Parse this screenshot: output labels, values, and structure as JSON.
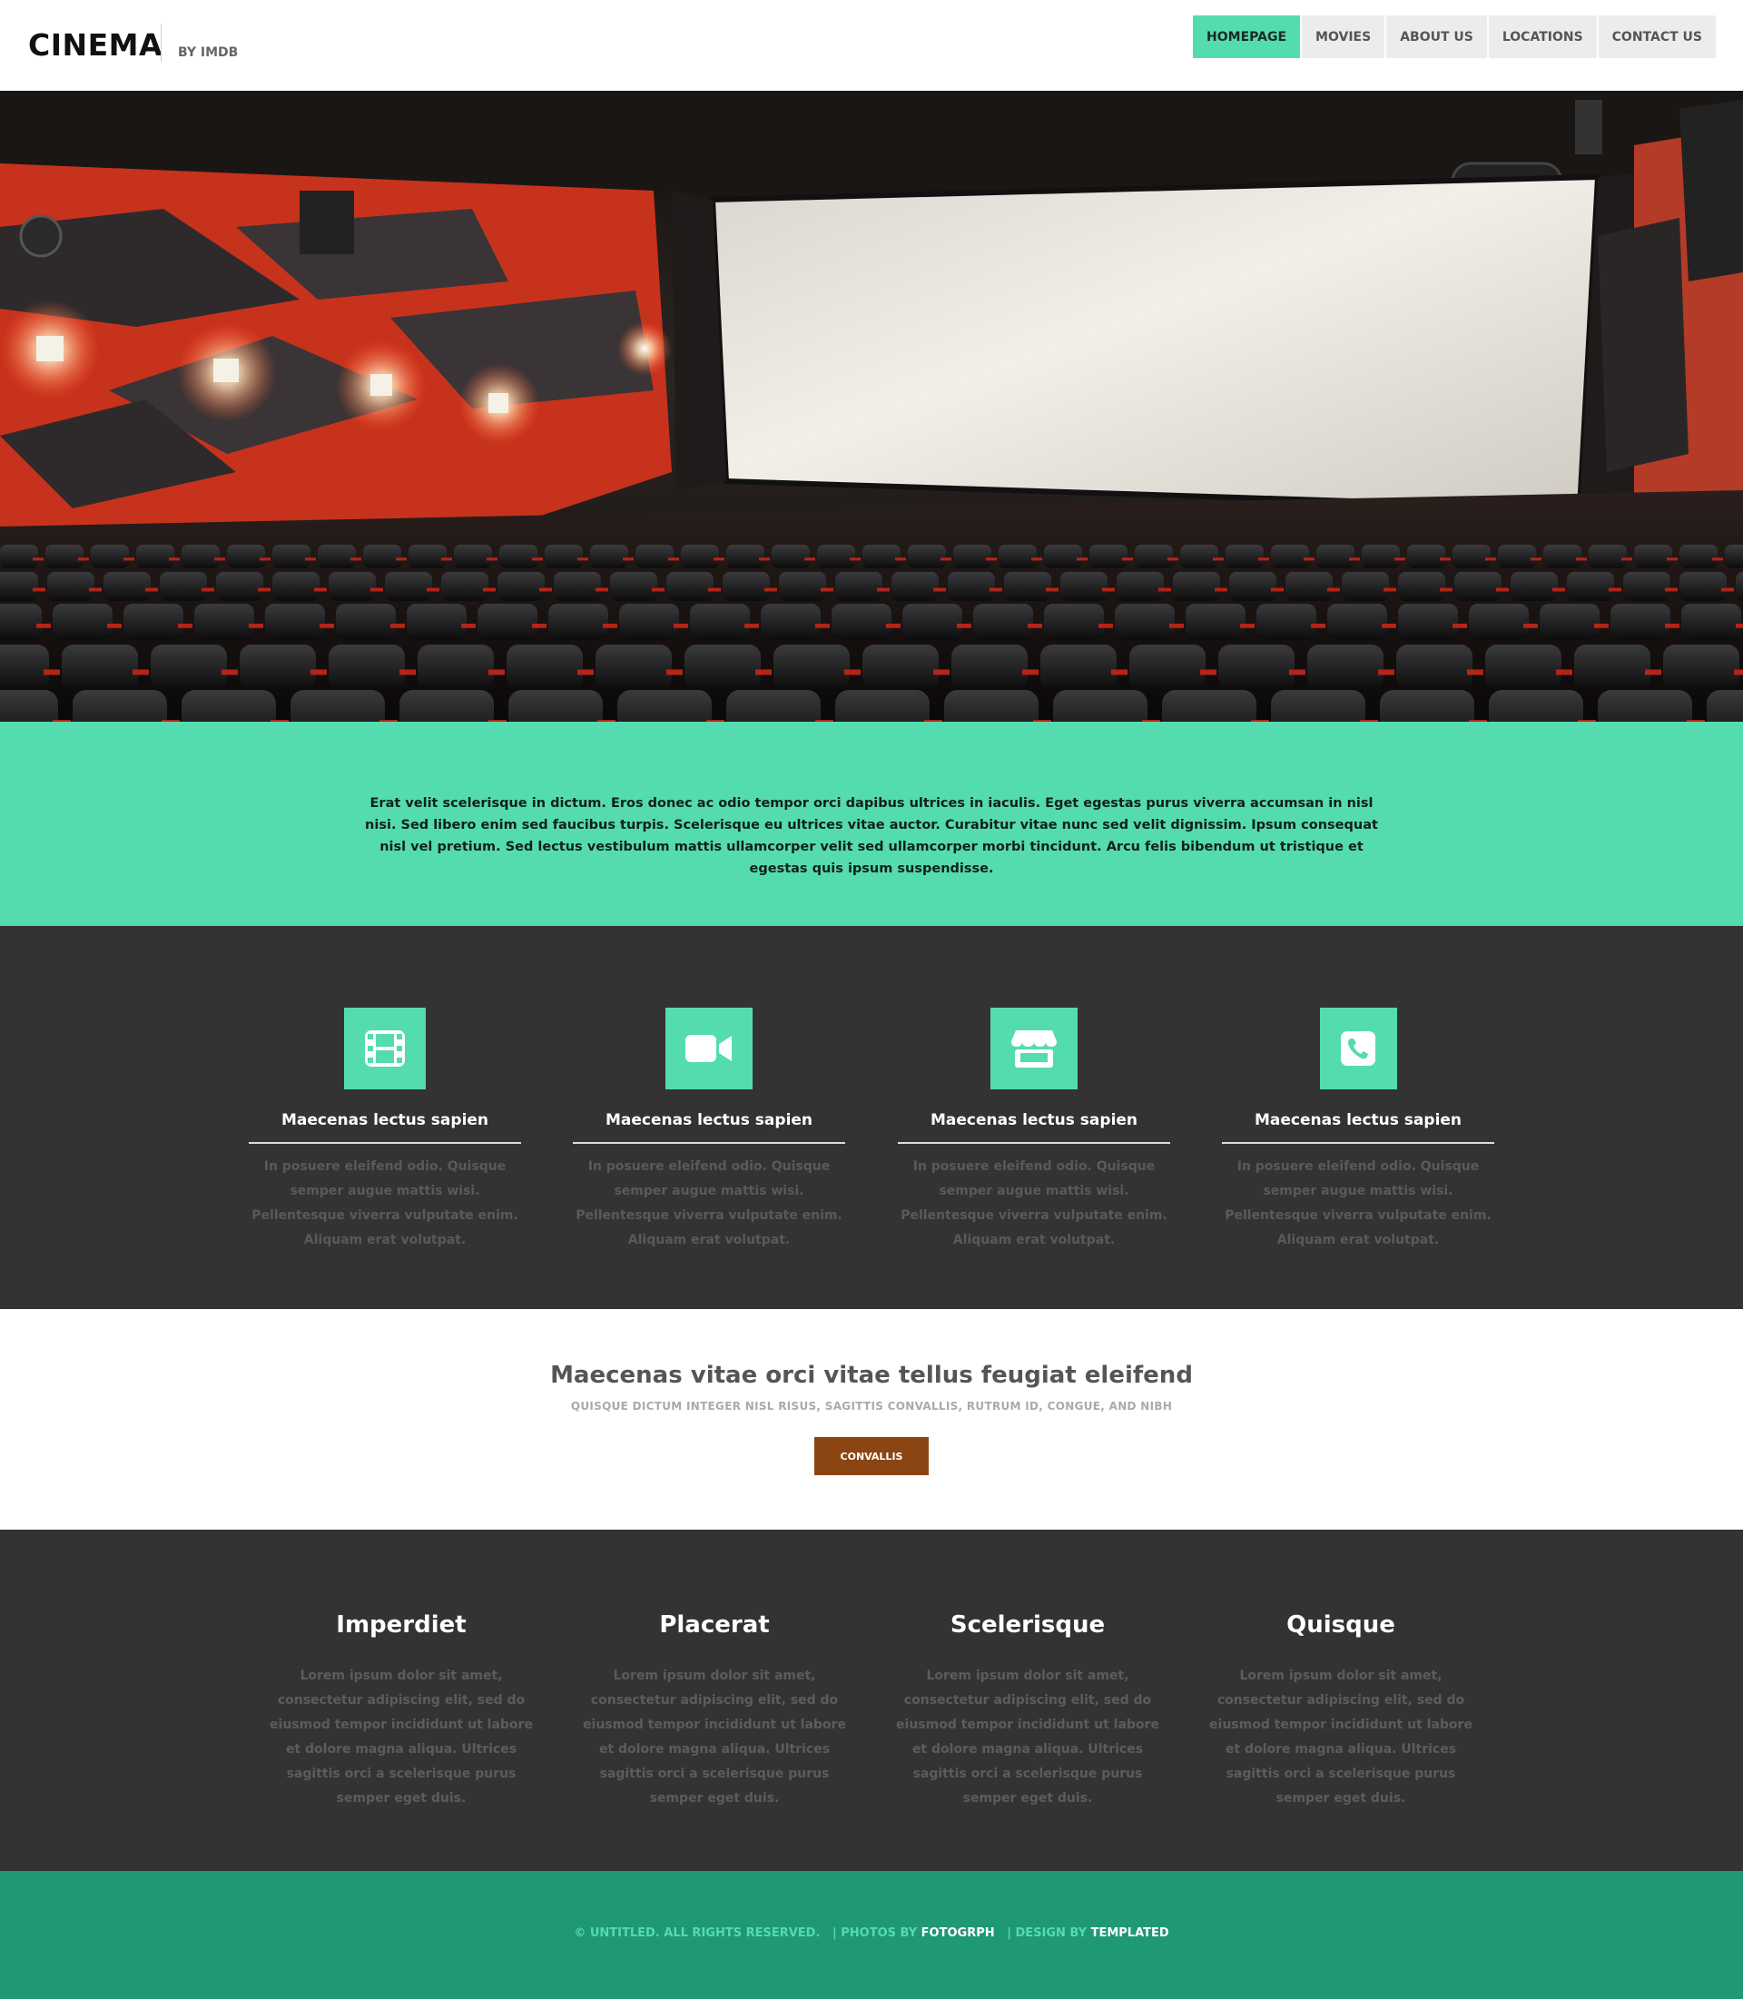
{
  "header": {
    "logo": "CINEMA",
    "logo_sub": "BY IMDB",
    "nav": [
      {
        "label": "HOMEPAGE",
        "active": true
      },
      {
        "label": "MOVIES",
        "active": false
      },
      {
        "label": "ABOUT US",
        "active": false
      },
      {
        "label": "LOCATIONS",
        "active": false
      },
      {
        "label": "CONTACT US",
        "active": false
      }
    ]
  },
  "intro": {
    "text": "Erat velit scelerisque in dictum. Eros donec ac odio tempor orci dapibus ultrices in iaculis. Eget egestas purus viverra accumsan in nisl nisi. Sed libero enim sed faucibus turpis. Scelerisque eu ultrices vitae auctor. Curabitur vitae nunc sed velit dignissim. Ipsum consequat nisl vel pretium. Sed lectus vestibulum mattis ullamcorper velit sed ullamcorper morbi tincidunt. Arcu felis bibendum ut tristique et egestas quis ipsum suspendisse."
  },
  "features": [
    {
      "icon": "film-icon",
      "title": "Maecenas lectus sapien",
      "text": "In posuere eleifend odio. Quisque semper augue mattis wisi. Pellentesque viverra vulputate enim. Aliquam erat volutpat."
    },
    {
      "icon": "video-camera-icon",
      "title": "Maecenas lectus sapien",
      "text": "In posuere eleifend odio. Quisque semper augue mattis wisi. Pellentesque viverra vulputate enim. Aliquam erat volutpat."
    },
    {
      "icon": "store-icon",
      "title": "Maecenas lectus sapien",
      "text": "In posuere eleifend odio. Quisque semper augue mattis wisi. Pellentesque viverra vulputate enim. Aliquam erat volutpat."
    },
    {
      "icon": "phone-icon",
      "title": "Maecenas lectus sapien",
      "text": "In posuere eleifend odio. Quisque semper augue mattis wisi. Pellentesque viverra vulputate enim. Aliquam erat volutpat."
    }
  ],
  "cta": {
    "title": "Maecenas vitae orci vitae tellus feugiat eleifend",
    "subtitle": "QUISQUE DICTUM INTEGER NISL RISUS, SAGITTIS CONVALLIS, RUTRUM ID, CONGUE, AND NIBH",
    "button": "CONVALLIS"
  },
  "columns": [
    {
      "title": "Imperdiet",
      "text": "Lorem ipsum dolor sit amet, consectetur adipiscing elit, sed do eiusmod tempor incididunt ut labore et dolore magna aliqua. Ultrices sagittis orci a scelerisque purus semper eget duis."
    },
    {
      "title": "Placerat",
      "text": "Lorem ipsum dolor sit amet, consectetur adipiscing elit, sed do eiusmod tempor incididunt ut labore et dolore magna aliqua. Ultrices sagittis orci a scelerisque purus semper eget duis."
    },
    {
      "title": "Scelerisque",
      "text": "Lorem ipsum dolor sit amet, consectetur adipiscing elit, sed do eiusmod tempor incididunt ut labore et dolore magna aliqua. Ultrices sagittis orci a scelerisque purus semper eget duis."
    },
    {
      "title": "Quisque",
      "text": "Lorem ipsum dolor sit amet, consectetur adipiscing elit, sed do eiusmod tempor incididunt ut labore et dolore magna aliqua. Ultrices sagittis orci a scelerisque purus semper eget duis."
    }
  ],
  "footer": {
    "copyright": "© UNTITLED. ALL RIGHTS RESERVED.",
    "photos_prefix": "| PHOTOS BY",
    "photos_by": "FOTOGRPH",
    "design_prefix": "| DESIGN BY",
    "design_by": "TEMPLATED"
  },
  "colors": {
    "accent": "#55dbb0",
    "dark": "#333333",
    "footer": "#1f9874",
    "button": "#8b4513"
  }
}
